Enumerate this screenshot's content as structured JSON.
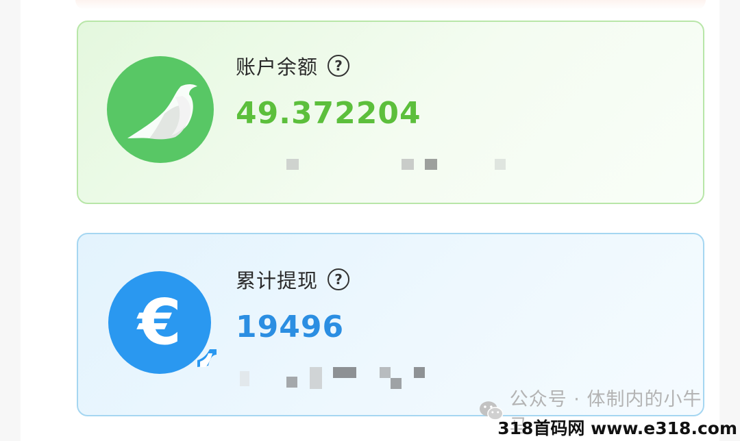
{
  "balance_card": {
    "label": "账户余额",
    "help_symbol": "?",
    "amount": "49.372204",
    "icon": "bird-icon",
    "accent_color": "#5cbf3c"
  },
  "withdraw_card": {
    "label": "累计提现",
    "help_symbol": "?",
    "amount": "19496",
    "icon": "euro-icon",
    "accent_color": "#2b8ee2"
  },
  "watermark": {
    "text": "公众号 · 体制内的小牛马",
    "icon": "wechat-icon"
  },
  "site_mark": "318首码网 www.e318.com"
}
